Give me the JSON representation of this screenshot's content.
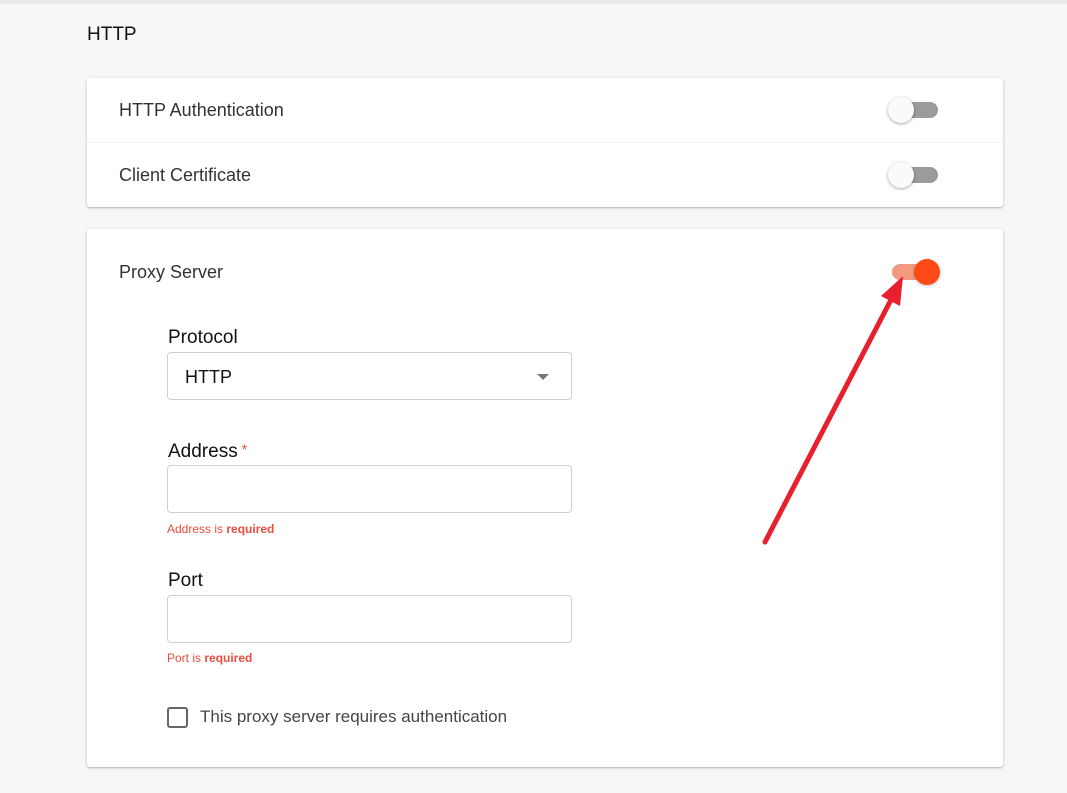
{
  "section_title": "HTTP",
  "rows": [
    {
      "label": "HTTP Authentication",
      "enabled": false
    },
    {
      "label": "Client Certificate",
      "enabled": false
    }
  ],
  "proxy": {
    "label": "Proxy Server",
    "enabled": true,
    "protocol": {
      "label": "Protocol",
      "value": "HTTP"
    },
    "address": {
      "label": "Address",
      "required_mark": "*",
      "value": "",
      "error_prefix": "Address is ",
      "error_strong": "required"
    },
    "port": {
      "label": "Port",
      "value": "",
      "error_prefix": "Port is ",
      "error_strong": "required"
    },
    "auth_checkbox": {
      "label": "This proxy server requires authentication",
      "checked": false
    }
  },
  "colors": {
    "accent": "#ff4a17",
    "accent_track": "#f39a80",
    "error": "#e74c3c",
    "annotation": "#e8202e"
  }
}
